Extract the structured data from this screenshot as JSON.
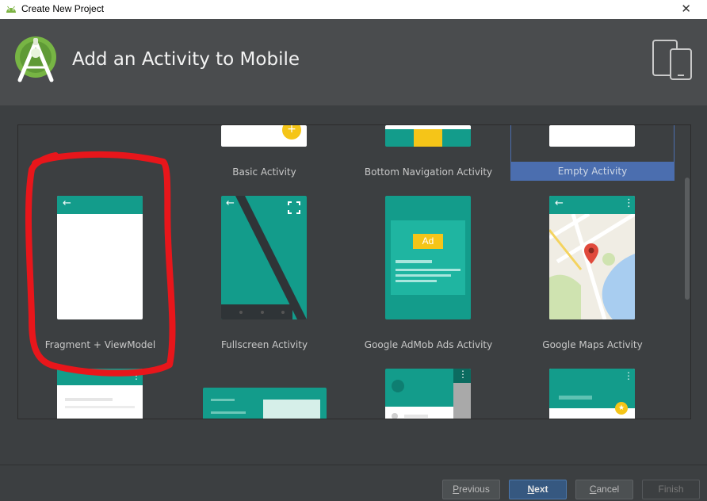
{
  "window": {
    "title": "Create New Project"
  },
  "header": {
    "title": "Add an Activity to Mobile"
  },
  "activities": [
    {
      "label": "Basic Activity"
    },
    {
      "label": "Bottom Navigation Activity"
    },
    {
      "label": "Empty Activity",
      "selected": true
    },
    {
      "label": "Fragment + ViewModel"
    },
    {
      "label": "Fullscreen Activity"
    },
    {
      "label": "Google AdMob Ads Activity",
      "ad_badge": "Ad"
    },
    {
      "label": "Google Maps Activity"
    }
  ],
  "buttons": {
    "previous": {
      "pre": "",
      "mnemonic": "P",
      "post": "revious"
    },
    "next": {
      "pre": "",
      "mnemonic": "N",
      "post": "ext"
    },
    "cancel": {
      "pre": "",
      "mnemonic": "C",
      "post": "ancel"
    },
    "finish": {
      "label": "Finish"
    }
  },
  "colors": {
    "accent_teal": "#139c8b",
    "selection": "#4b6eaf",
    "fab_yellow": "#f5c518",
    "annotation_red": "#e8161b"
  },
  "icons": [
    "android-icon",
    "android-studio-logo",
    "devices-icon",
    "close-icon",
    "back-arrow-icon",
    "fullscreen-icon",
    "overflow-menu-icon",
    "map-pin-icon",
    "star-icon"
  ]
}
